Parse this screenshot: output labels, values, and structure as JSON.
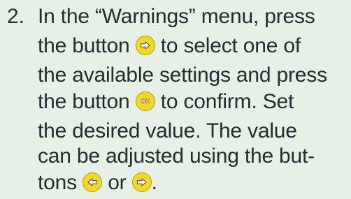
{
  "step": {
    "number": "2.",
    "lines": {
      "l1": "In the “Warnings” menu, press",
      "l2_a": "the button",
      "l2_b": "to select one of",
      "l3": "the available settings and press",
      "l4_a": "the button",
      "l4_b": "to confirm. Set",
      "l5": "the desired value. The value",
      "l6": "can be adjusted using the but-",
      "l7_a": "tons",
      "l7_b": "or",
      "l7_c": "."
    }
  },
  "buttons": {
    "ok_label": "OK",
    "color": "#f3d91f"
  },
  "icons": [
    "right-arrow-button-icon",
    "ok-button-icon",
    "left-arrow-button-icon",
    "right-arrow-button-icon"
  ]
}
